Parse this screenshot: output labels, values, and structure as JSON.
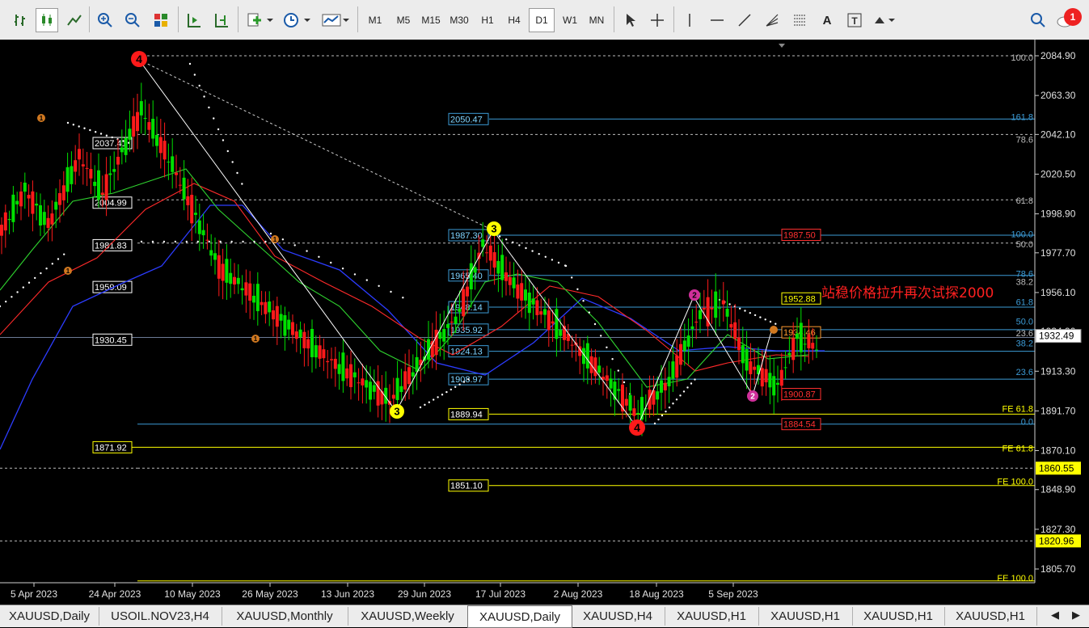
{
  "toolbar": {
    "icons": [
      "bar-chart-icon",
      "candlestick-icon",
      "line-chart-icon",
      "zoom-in-icon",
      "zoom-out-icon",
      "tile-windows-icon",
      "autoscroll-icon",
      "chart-shift-icon",
      "new-order-icon",
      "clock-icon",
      "templates-icon"
    ],
    "timeframes": [
      "M1",
      "M5",
      "M15",
      "M30",
      "H1",
      "H4",
      "D1",
      "W1",
      "MN"
    ],
    "active_timeframe": "D1",
    "draw_tools": [
      "cursor-icon",
      "crosshair-icon",
      "vertical-line-icon",
      "horizontal-line-icon",
      "trendline-icon",
      "fibo-fan-icon",
      "fibo-retracement-icon",
      "text-icon",
      "text-label-icon",
      "arrows-icon"
    ],
    "text_tool": "A",
    "label_tool": "T",
    "notification_count": "1"
  },
  "chart_data": {
    "type": "candlestick",
    "symbol": "XAUUSD",
    "timeframe": "Daily",
    "ylim": [
      1795,
      2095
    ],
    "y_ticks": [
      "2084.90",
      "2063.30",
      "2042.10",
      "2020.50",
      "1998.90",
      "1977.70",
      "1956.10",
      "1934.90",
      "1913.30",
      "1891.70",
      "1870.10",
      "1848.90",
      "1827.30",
      "1805.70"
    ],
    "current_price": "1932.49",
    "price_markers": [
      {
        "label": "1860.55",
        "price": 1860.55
      },
      {
        "label": "1820.96",
        "price": 1820.96
      }
    ],
    "x_labels": [
      "5 Apr 2023",
      "24 Apr 2023",
      "10 May 2023",
      "26 May 2023",
      "13 Jun 2023",
      "29 Jun 2023",
      "17 Jul 2023",
      "2 Aug 2023",
      "18 Aug 2023",
      "5 Sep 2023"
    ],
    "left_levels": [
      "2037.41",
      "2004.99",
      "1981.83",
      "1959.09",
      "1930.45",
      "1871.92"
    ],
    "mid_levels": [
      "2050.47",
      "1987.30",
      "1965.40",
      "1948.14",
      "1935.92",
      "1924.13",
      "1908.97",
      "1889.94",
      "1851.10"
    ],
    "right_levels": [
      "1987.50",
      "1952.88",
      "1934.46",
      "1900.87",
      "1884.54"
    ],
    "fib_labels": [
      "100.0",
      "161.8",
      "78.6",
      "61.8",
      "100.0",
      "50.0",
      "78.6",
      "38.2",
      "61.8",
      "50.0",
      "23.6",
      "38.2",
      "23.6",
      "FE 61.8",
      "0.0",
      "FE 61.8",
      "FE 100.0",
      "FE 100.0"
    ],
    "wave_labels": [
      "4",
      "3",
      "3",
      "4",
      "2",
      "2",
      "1",
      "1",
      "1",
      "1"
    ],
    "annotation": "站稳价格拉升再次试探2000"
  },
  "tabs": [
    {
      "label": "XAUUSD,Daily"
    },
    {
      "label": "USOIL.NOV23,H4"
    },
    {
      "label": "XAUUSD,Monthly"
    },
    {
      "label": "XAUUSD,Weekly"
    },
    {
      "label": "XAUUSD,Daily"
    },
    {
      "label": "XAUUSD,H4"
    },
    {
      "label": "XAUUSD,H1"
    },
    {
      "label": "XAUUSD,H1"
    },
    {
      "label": "XAUUSD,H1"
    },
    {
      "label": "XAUUSD,H1"
    }
  ],
  "active_tab_index": 4,
  "colors": {
    "bull": "#00e000",
    "bear": "#ff1a1a",
    "fib": "#3c9bd6",
    "fe": "#ffff00",
    "grid": "#bbbbbb"
  }
}
